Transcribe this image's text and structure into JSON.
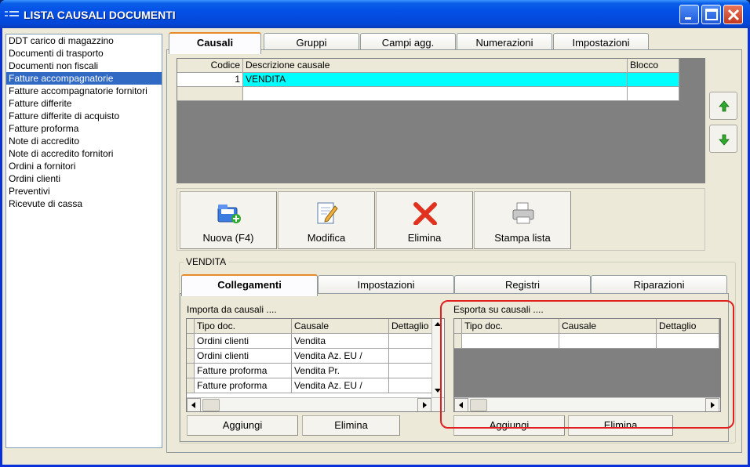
{
  "window": {
    "title": "LISTA CAUSALI DOCUMENTI"
  },
  "doc_types": [
    "DDT carico di magazzino",
    "Documenti di trasporto",
    "Documenti non fiscali",
    "Fatture accompagnatorie",
    "Fatture accompagnatorie fornitori",
    "Fatture differite",
    "Fatture differite di acquisto",
    "Fatture proforma",
    "Note di accredito",
    "Note di accredito fornitori",
    "Ordini a fornitori",
    "Ordini clienti",
    "Preventivi",
    "Ricevute di cassa"
  ],
  "selected_doc_index": 3,
  "main_tabs": [
    "Causali",
    "Gruppi",
    "Campi agg.",
    "Numerazioni",
    "Impostazioni"
  ],
  "causali_grid": {
    "headers": [
      "Codice",
      "Descrizione causale",
      "Blocco"
    ],
    "rows": [
      {
        "codice": "1",
        "descrizione": "VENDITA",
        "blocco": ""
      }
    ]
  },
  "actions": [
    "Nuova (F4)",
    "Modifica",
    "Elimina",
    "Stampa lista"
  ],
  "group_label": "VENDITA",
  "sub_tabs": [
    "Collegamenti",
    "Impostazioni",
    "Registri",
    "Riparazioni"
  ],
  "import_section": {
    "label": "Importa da causali ....",
    "headers": [
      "Tipo doc.",
      "Causale",
      "Dettaglio"
    ],
    "rows": [
      [
        "Ordini clienti",
        "Vendita",
        ""
      ],
      [
        "Ordini clienti",
        "Vendita Az. EU /",
        ""
      ],
      [
        "Fatture proforma",
        "Vendita Pr.",
        ""
      ],
      [
        "Fatture proforma",
        "Vendita Az. EU /",
        ""
      ]
    ],
    "add_label": "Aggiungi",
    "delete_label": "Elimina"
  },
  "export_section": {
    "label": "Esporta su causali ....",
    "headers": [
      "Tipo doc.",
      "Causale",
      "Dettaglio"
    ],
    "add_label": "Aggiungi",
    "delete_label": "Elimina"
  },
  "colors": {
    "selection": "#316ac5",
    "row_highlight": "#00ffff",
    "annotation": "#e02020"
  }
}
